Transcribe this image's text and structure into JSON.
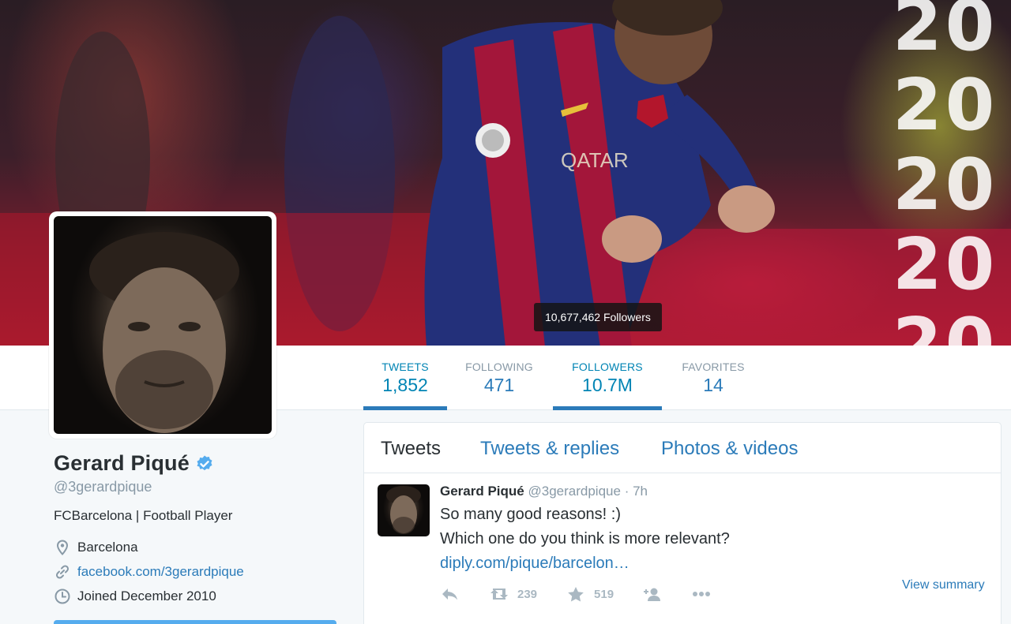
{
  "profile": {
    "name": "Gerard Piqué",
    "handle": "@3gerardpique",
    "bio": "FCBarcelona | Football Player",
    "location": "Barcelona",
    "website": "facebook.com/3gerardpique",
    "joined": "Joined December 2010"
  },
  "banner": {
    "years": [
      "20",
      "20",
      "20",
      "20",
      "20"
    ],
    "tooltip": "10,677,462 Followers"
  },
  "stats": [
    {
      "label": "TWEETS",
      "value": "1,852"
    },
    {
      "label": "FOLLOWING",
      "value": "471"
    },
    {
      "label": "FOLLOWERS",
      "value": "10.7M"
    },
    {
      "label": "FAVORITES",
      "value": "14"
    }
  ],
  "tabs": [
    "Tweets",
    "Tweets & replies",
    "Photos & videos"
  ],
  "tweet": {
    "name": "Gerard Piqué",
    "handle": "@3gerardpique",
    "separator": "·",
    "time": "7h",
    "lines": [
      "So many good reasons! :)",
      "Which one do you think is more relevant?"
    ],
    "link": "diply.com/pique/barcelon…",
    "retweets": "239",
    "favorites": "519",
    "view_summary": "View summary"
  },
  "colors": {
    "accent": "#2b7bb9",
    "verified": "#55acee",
    "muted": "#8899a6"
  }
}
